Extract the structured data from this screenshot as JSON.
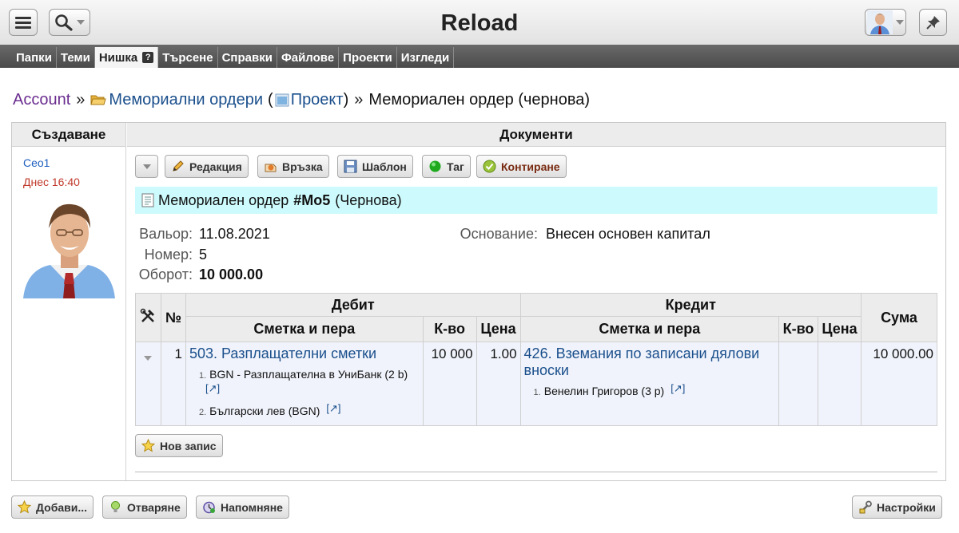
{
  "app": {
    "title": "Reload"
  },
  "tabs": [
    {
      "label": "Папки",
      "active": false
    },
    {
      "label": "Теми",
      "active": false
    },
    {
      "label": "Нишка",
      "active": true
    },
    {
      "label": "Търсене",
      "active": false
    },
    {
      "label": "Справки",
      "active": false
    },
    {
      "label": "Файлове",
      "active": false
    },
    {
      "label": "Проекти",
      "active": false
    },
    {
      "label": "Изгледи",
      "active": false
    }
  ],
  "breadcrumb": {
    "account": "Account",
    "sep": "»",
    "folder": "Мемориални ордери",
    "paren_open": "(",
    "project": "Проект",
    "paren_close": ")",
    "sep2": "»",
    "current": "Мемориален ордер (чернова)"
  },
  "left_column": {
    "header": "Създаване",
    "creator": "Ceo1",
    "time": "Днес 16:40"
  },
  "right_column": {
    "header": "Документи"
  },
  "toolbar": {
    "edit": "Редакция",
    "link": "Връзка",
    "template": "Шаблон",
    "tag": "Таг",
    "post": "Контиране"
  },
  "document": {
    "title_prefix": "Мемориален ордер",
    "number_tag": "#Mo5",
    "status": "(Чернова)",
    "valor_label": "Вальор:",
    "valor_value": "11.08.2021",
    "number_label": "Номер:",
    "number_value": "5",
    "turnover_label": "Оборот:",
    "turnover_value": "10 000.00",
    "basis_label": "Основание:",
    "basis_value": "Внесен основен капитал"
  },
  "ledger": {
    "headers": {
      "no": "№",
      "debit": "Дебит",
      "credit": "Кредит",
      "account": "Сметка и пера",
      "qty": "К-во",
      "price": "Цена",
      "amount": "Сума"
    },
    "rows": [
      {
        "no": "1",
        "debit_account": "503. Разплащателни сметки",
        "debit_items": [
          {
            "num": "1.",
            "text": "BGN - Разплащателна в УниБанк (2 b)"
          },
          {
            "num": "2.",
            "text": "Български лев (BGN)"
          }
        ],
        "debit_qty": "10 000",
        "debit_price": "1.00",
        "credit_account": "426. Вземания по записани дялови вноски",
        "credit_items": [
          {
            "num": "1.",
            "text": "Венелин Григоров (3 p)"
          }
        ],
        "credit_qty": "",
        "credit_price": "",
        "amount": "10 000.00"
      }
    ],
    "ext_link": "[↗]"
  },
  "new_entry_button": "Нов запис",
  "footer": {
    "add": "Добави...",
    "close": "Отваряне",
    "remind": "Напомняне",
    "settings": "Настройки"
  }
}
